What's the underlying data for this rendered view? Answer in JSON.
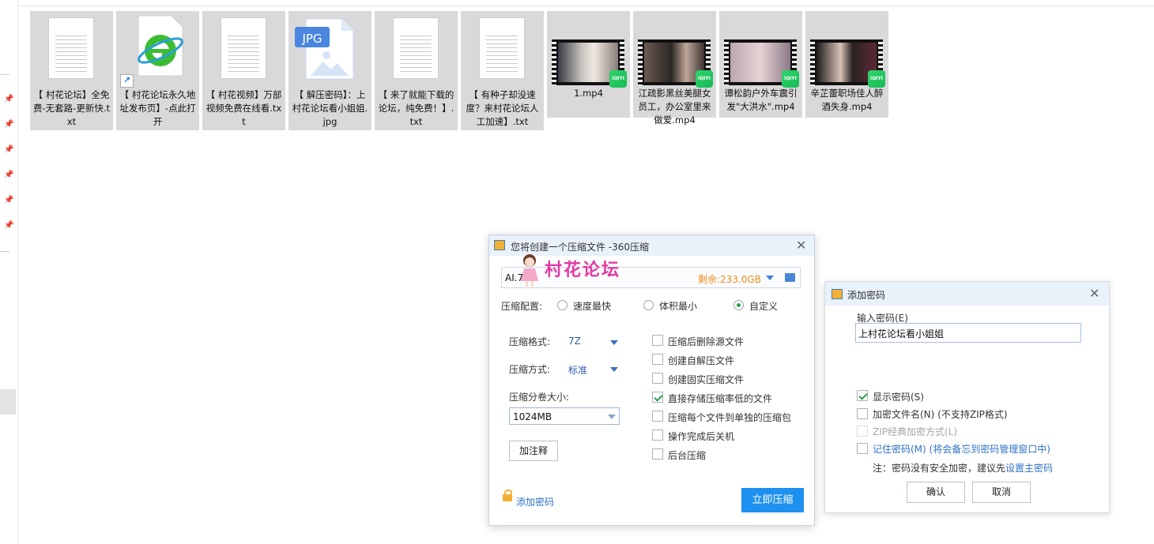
{
  "files": [
    {
      "name": "【 村花论坛】全免费-无套路-更新快.txt",
      "kind": "txt"
    },
    {
      "name": "【 村花论坛永久地址发布页】-点此打开",
      "kind": "ie-shortcut"
    },
    {
      "name": "【 村花视频】万部视频免费在线看.txt",
      "kind": "txt"
    },
    {
      "name": "【 解压密码】：上村花论坛看小姐姐.jpg",
      "kind": "jpg",
      "badge": "JPG"
    },
    {
      "name": "【 来了就能下载的论坛，纯免费！】.txt",
      "kind": "txt"
    },
    {
      "name": "【 有种子却没速度？来村花论坛人工加速】.txt",
      "kind": "txt"
    },
    {
      "name": "1.mp4",
      "kind": "video",
      "badge": "iQIYI"
    },
    {
      "name": "江疏影黑丝美腿女员工，办公室里来做爱.mp4",
      "kind": "video",
      "badge": "iQIYI"
    },
    {
      "name": "谭松韵户外车震引发\"大洪水\".mp4",
      "kind": "video",
      "badge": "iQIYI"
    },
    {
      "name": "辛芷蕾职场佳人醉酒失身.mp4",
      "kind": "video",
      "badge": "iQIYI"
    }
  ],
  "compress_dialog": {
    "title": "您将创建一个压缩文件 -360压缩",
    "path": "AI.7z",
    "free_space": "剩余:233.0GB",
    "watermark": "村花论坛",
    "config_label": "压缩配置:",
    "config_options": [
      "速度最快",
      "体积最小",
      "自定义"
    ],
    "config_selected": "自定义",
    "format_label": "压缩格式:",
    "format_value": "7Z",
    "method_label": "压缩方式:",
    "method_value": "标准",
    "volume_label": "压缩分卷大小:",
    "volume_value": "1024MB",
    "comment_button": "加注释",
    "options": [
      {
        "label": "压缩后删除源文件",
        "checked": false
      },
      {
        "label": "创建自解压文件",
        "checked": false
      },
      {
        "label": "创建固实压缩文件",
        "checked": false
      },
      {
        "label": "直接存储压缩率低的文件",
        "checked": true
      },
      {
        "label": "压缩每个文件到单独的压缩包",
        "checked": false
      },
      {
        "label": "操作完成后关机",
        "checked": false
      },
      {
        "label": "后台压缩",
        "checked": false
      }
    ],
    "add_password": "添加密码",
    "start_button": "立即压缩"
  },
  "password_dialog": {
    "title": "添加密码",
    "input_label": "输入密码(E)",
    "password": "上村花论坛看小姐姐",
    "show_password": "显示密码(S)",
    "encrypt_names": "加密文件名(N)",
    "encrypt_names_note": "(不支持ZIP格式)",
    "zip_classic": "ZIP经典加密方式(L)",
    "remember": "记住密码(M) (将会备忘到密码管理窗口中)",
    "note_prefix": "注：密码没有安全加密，建议先",
    "note_link": "设置主密码",
    "ok": "确认",
    "cancel": "取消"
  },
  "colors": {
    "accent": "#1e90f0",
    "free_space": "#f08a16",
    "watermark": "#e33aa4",
    "check": "#2a9d4a"
  }
}
